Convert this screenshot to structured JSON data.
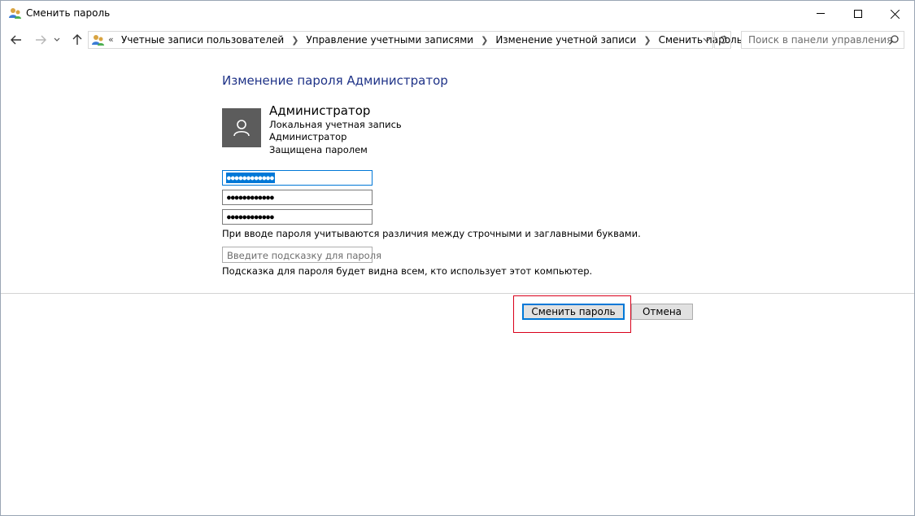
{
  "window": {
    "title": "Сменить пароль",
    "icon": "user-accounts-icon"
  },
  "nav": {
    "more_glyph": "«",
    "breadcrumbs": [
      "Учетные записи пользователей",
      "Управление учетными записями",
      "Изменение учетной записи",
      "Сменить пароль"
    ],
    "search_placeholder": "Поиск в панели управления"
  },
  "content": {
    "heading": "Изменение пароля Администратор",
    "user": {
      "name": "Администратор",
      "lines": [
        "Локальная учетная запись",
        "Администратор",
        "Защищена паролем"
      ]
    },
    "password_fields": [
      "●●●●●●●●●●●●",
      "●●●●●●●●●●●●",
      "●●●●●●●●●●●●"
    ],
    "case_note": "При вводе пароля учитываются различия между строчными и заглавными буквами.",
    "hint_placeholder": "Введите подсказку для пароля",
    "hint_note": "Подсказка для пароля будет видна всем, кто использует этот компьютер."
  },
  "buttons": {
    "change": "Сменить пароль",
    "cancel": "Отмена"
  },
  "colors": {
    "heading": "#1e3287",
    "accent": "#0078d7",
    "highlight": "#d9001b",
    "avatar_bg": "#5c5c5c"
  }
}
